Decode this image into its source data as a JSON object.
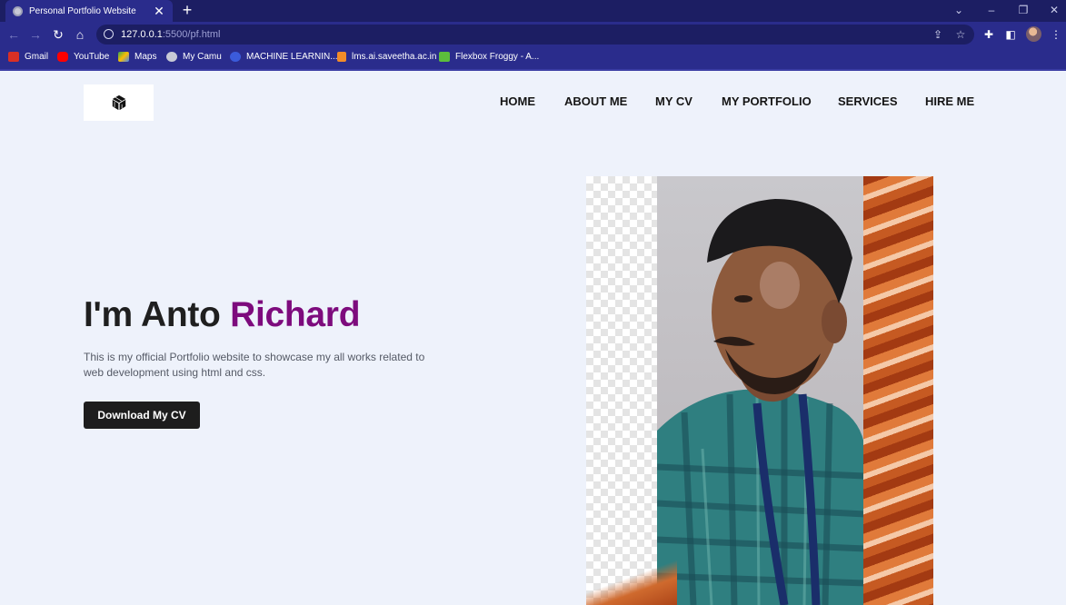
{
  "browser": {
    "tab": {
      "title": "Personal Portfolio Website",
      "close": "✕",
      "favicon": "globe-icon"
    },
    "new_tab": "+",
    "window_controls": [
      "⌄",
      "–",
      "❐",
      "✕"
    ],
    "url": {
      "host": "127.0.0.1",
      "rest": ":5500/pf.html"
    },
    "bookmarks": [
      {
        "label": "Gmail",
        "icon": "gmail-icon",
        "color": "#d93025"
      },
      {
        "label": "YouTube",
        "icon": "youtube-icon",
        "color": "#ff0000"
      },
      {
        "label": "Maps",
        "icon": "maps-icon",
        "color": "#34a853"
      },
      {
        "label": "My Camu",
        "icon": "globe-icon",
        "color": "#c7c9d6"
      },
      {
        "label": "MACHINE LEARNIN...",
        "icon": "site-icon",
        "color": "#3b5bdb"
      },
      {
        "label": "lms.ai.saveetha.ac.in",
        "icon": "moodle-icon",
        "color": "#f28c28"
      },
      {
        "label": "Flexbox Froggy - A...",
        "icon": "frog-icon",
        "color": "#5cbd3c"
      }
    ]
  },
  "site": {
    "logo": "cube-logo-icon",
    "nav": [
      "HOME",
      "ABOUT ME",
      "MY CV",
      "MY PORTFOLIO",
      "SERVICES",
      "HIRE ME"
    ],
    "hero": {
      "title_prefix": "I'm Anto ",
      "title_accent": "Richard",
      "description": "This is my official Portfolio website to showcase my all works related to web development using html and css.",
      "button": "Download My CV"
    },
    "colors": {
      "accent": "#7d0b7d",
      "button": "#1d1d1d",
      "background": "#eef2fb",
      "chrome": "#2a2c8c"
    }
  }
}
